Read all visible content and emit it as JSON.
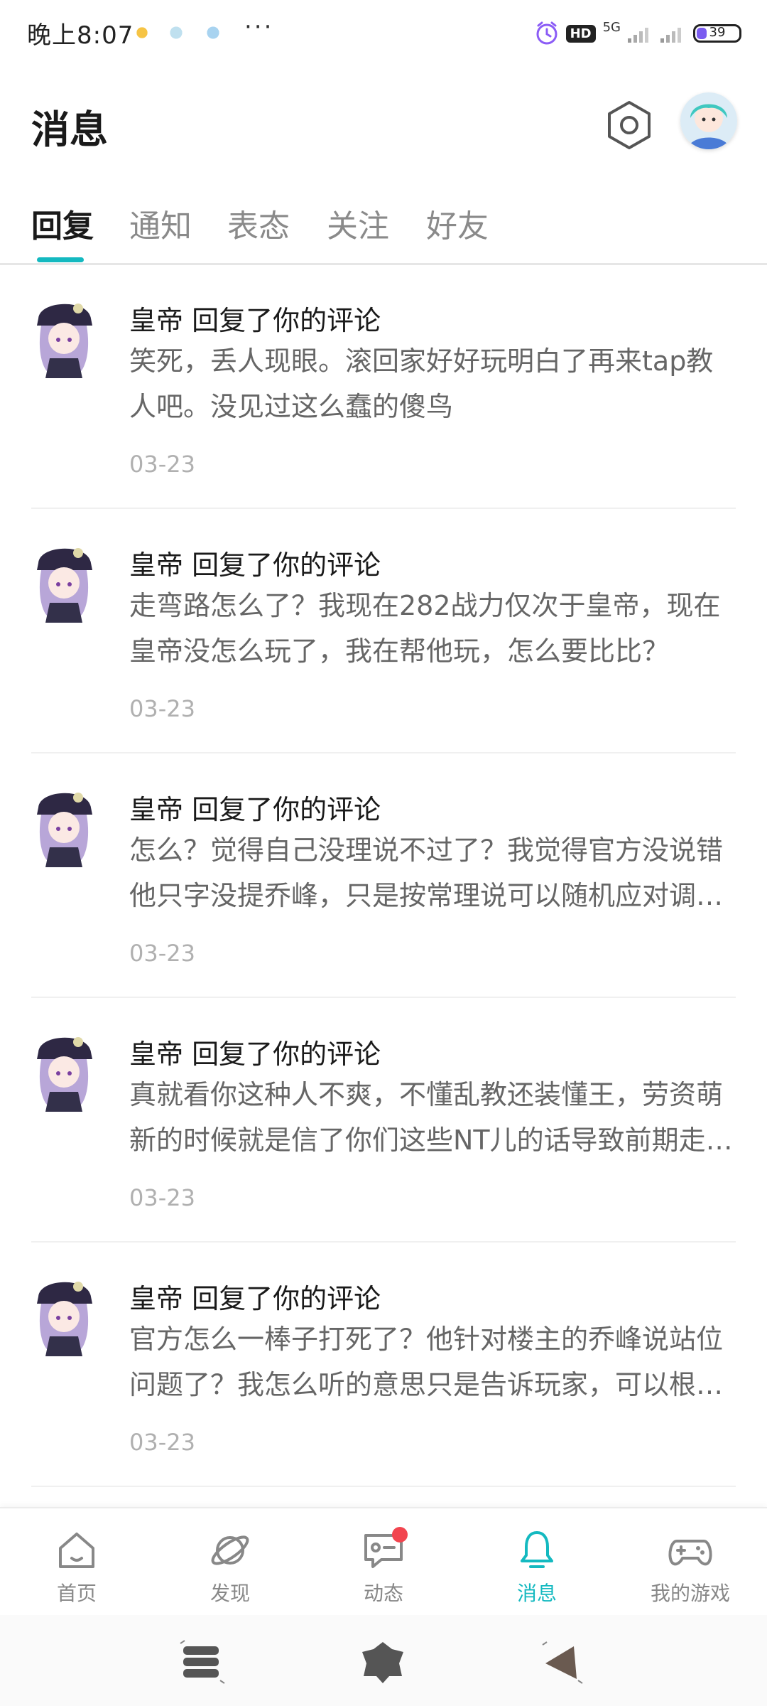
{
  "status_bar": {
    "time": "晚上8:07",
    "dots": "···",
    "hd_label": "HD",
    "network_label": "5G",
    "battery_level": "39",
    "battery_color": "#7b5cf0"
  },
  "header": {
    "title": "消息",
    "settings_icon": "hexagon-settings-icon",
    "avatar_icon": "user-avatar"
  },
  "tabs": [
    {
      "label": "回复",
      "active": true
    },
    {
      "label": "通知",
      "active": false
    },
    {
      "label": "表态",
      "active": false
    },
    {
      "label": "关注",
      "active": false
    },
    {
      "label": "好友",
      "active": false
    }
  ],
  "messages": [
    {
      "title": "皇帝 回复了你的评论",
      "body": "笑死，丢人现眼。滚回家好好玩明白了再来tap教人吧。没见过这么蠢的傻鸟",
      "date": "03-23"
    },
    {
      "title": "皇帝 回复了你的评论",
      "body": "走弯路怎么了？我现在282战力仅次于皇帝，现在皇帝没怎么玩了，我在帮他玩，怎么要比比？",
      "date": "03-23"
    },
    {
      "title": "皇帝 回复了你的评论",
      "body": "怎么？觉得自己没理说不过了？我觉得官方没说错他只字没提乔峰，只是按常理说可以随机应对调整站位",
      "date": "03-23"
    },
    {
      "title": "皇帝 回复了你的评论",
      "body": "真就看你这种人不爽，不懂乱教还装懂王，劳资萌新的时候就是信了你们这些NT儿的话导致前期走了不少弯路",
      "date": "03-23"
    },
    {
      "title": "皇帝 回复了你的评论",
      "body": "官方怎么一棒子打死了？他针对楼主的乔峰说站位问题了？我怎么听的意思只是告诉玩家，可以根据情况调整",
      "date": "03-23"
    }
  ],
  "bottom_nav": [
    {
      "label": "首页",
      "icon": "home-icon",
      "active": false
    },
    {
      "label": "发现",
      "icon": "planet-icon",
      "active": false
    },
    {
      "label": "动态",
      "icon": "chat-icon",
      "active": false,
      "badge": true
    },
    {
      "label": "消息",
      "icon": "bell-icon",
      "active": true
    },
    {
      "label": "我的游戏",
      "icon": "gamepad-icon",
      "active": false
    }
  ],
  "colors": {
    "accent": "#14b9c0",
    "badge": "#f2454f",
    "title": "#1a1a1a",
    "body": "#666666",
    "date": "#b0b0b0"
  }
}
